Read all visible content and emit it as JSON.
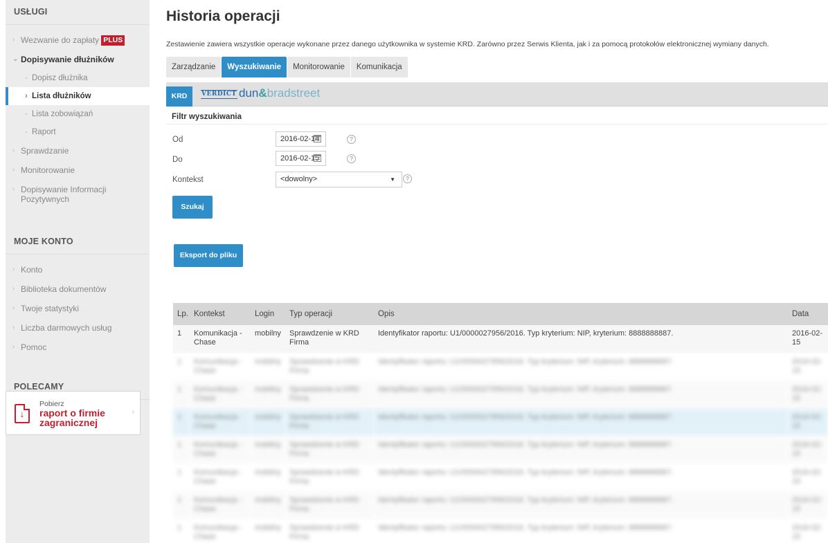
{
  "sidebar": {
    "section_services": "USŁUGI",
    "services": [
      {
        "label": "Wezwanie do zapłaty",
        "badge": "PLUS"
      },
      {
        "label": "Dopisywanie dłużników"
      },
      {
        "label": "Sprawdzanie"
      },
      {
        "label": "Monitorowanie"
      },
      {
        "label": "Dopisywanie Informacji Pozytywnych"
      }
    ],
    "subitems": [
      {
        "label": "Dopisz dłużnika"
      },
      {
        "label": "Lista dłużników"
      },
      {
        "label": "Lista zobowiązań"
      },
      {
        "label": "Raport"
      }
    ],
    "section_account": "MOJE KONTO",
    "account": [
      {
        "label": "Konto"
      },
      {
        "label": "Biblioteka dokumentów"
      },
      {
        "label": "Twoje statystyki"
      },
      {
        "label": "Liczba darmowych usług"
      },
      {
        "label": "Pomoc"
      }
    ],
    "section_recommended": "POLECAMY",
    "promo": {
      "line1": "Pobierz",
      "line2": "raport o firmie zagranicznej"
    }
  },
  "main": {
    "title": "Historia operacji",
    "description": "Zestawienie zawiera wszystkie operacje wykonane przez danego użytkownika w systemie KRD. Zarówno przez Serwis Klienta, jak i za pomocą protokołów elektronicznej wymiany danych.",
    "tabs": [
      "Zarządzanie",
      "Wyszukiwanie",
      "Monitorowanie",
      "Komunikacja"
    ],
    "active_tab": "Wyszukiwanie",
    "source_tab": "KRD",
    "db_logo": {
      "verdict": "VERDICT",
      "d1": "dun",
      "amp": "&",
      "d2": "bradstreet"
    },
    "filter": {
      "heading": "Filtr wyszukiwania",
      "from_label": "Od",
      "from_value": "2016-02-14",
      "to_label": "Do",
      "to_value": "2016-02-15",
      "context_label": "Kontekst",
      "context_value": "<dowolny>",
      "help": "?"
    },
    "search_button": "Szukaj",
    "export_button": "Eksport do pliku",
    "table": {
      "columns": [
        "Lp.",
        "Kontekst",
        "Login",
        "Typ operacji",
        "Opis",
        "Data"
      ],
      "rows": [
        {
          "lp": "1",
          "context": "Komunikacja - Chase",
          "login": "mobilny",
          "type": "Sprawdzenie w KRD Firma",
          "desc": "Identyfikator raportu: U1/0000027956/2016. Typ kryterium: NIP, kryterium: 8888888887.",
          "date": "2016-02-15"
        }
      ]
    }
  },
  "colors": {
    "accent": "#2f8dc7",
    "brand_red": "#c21f2e",
    "sidebar_bg": "#ececec",
    "highlight_row": "#cfe8f5"
  },
  "icons": [
    "calendar-icon",
    "help-icon",
    "chevron-right-icon",
    "download-icon"
  ]
}
